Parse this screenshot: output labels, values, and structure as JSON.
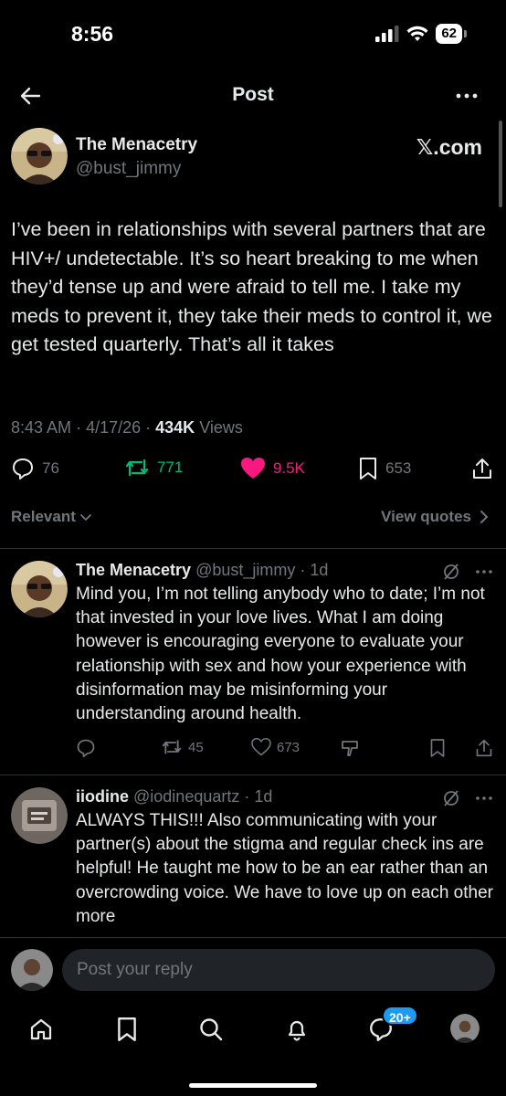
{
  "status_bar": {
    "time": "8:56",
    "battery": "62"
  },
  "header": {
    "title": "Post"
  },
  "post": {
    "author_name": "The Menacetry",
    "author_handle": "@bust_jimmy",
    "source_label": "𝕏.com",
    "body": "I’ve been in relationships with several partners that are HIV+/ undetectable. It’s so heart breaking to me when they’d tense up and were afraid to tell me. I take my meds to prevent it, they take their meds to control it, we get tested quarterly. That’s all it takes",
    "time": "8:43 AM",
    "date": "4/17/26",
    "views_count": "434K",
    "views_label": "Views",
    "replies": "76",
    "reposts": "771",
    "likes": "9.5K",
    "bookmarks": "653"
  },
  "sort": {
    "left_label": "Relevant",
    "right_label": "View quotes"
  },
  "replies": [
    {
      "name": "The Menacetry",
      "handle": "@bust_jimmy",
      "age": "1d",
      "body": "Mind you, I’m not telling anybody who to date; I’m not that invested in your love lives. What I am doing however is encouraging everyone to evaluate your relationship with sex and how your experience with disinformation may be misinforming your understanding around health.",
      "reposts": "45",
      "likes": "673"
    },
    {
      "name": "iiodine",
      "handle": "@iodinequartz",
      "age": "1d",
      "body": "ALWAYS THIS!!! Also communicating with your partner(s) about the stigma and regular check ins are helpful! He taught me how to be an ear rather than an overcrowding voice. We have to love up on each other more"
    }
  ],
  "composer": {
    "placeholder": "Post your reply"
  },
  "tabbar": {
    "notifications_badge": "20+"
  },
  "colors": {
    "like": "#f91880",
    "repost": "#00ba7c",
    "accent": "#1d9bf0",
    "muted": "#71767b"
  },
  "icons": [
    "back-arrow-icon",
    "more-icon",
    "reply-icon",
    "repost-icon",
    "heart-icon",
    "bookmark-icon",
    "share-icon",
    "grok-icon",
    "analytics-icon",
    "chevron-down-icon",
    "chevron-right-icon",
    "home-icon",
    "search-icon",
    "notifications-icon",
    "messages-icon"
  ]
}
